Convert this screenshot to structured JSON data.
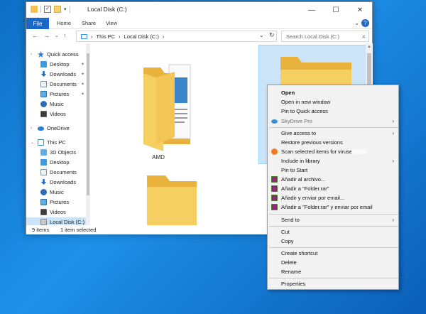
{
  "window": {
    "title": "Local Disk (C:)",
    "controls": [
      "—",
      "☐",
      "✕"
    ]
  },
  "ribbon": {
    "file_tab": "File",
    "tabs": [
      "Home",
      "Share",
      "View"
    ]
  },
  "address": {
    "back": "←",
    "forward": "→",
    "recent": "⌄",
    "up": "↑",
    "crumbs": [
      "This PC",
      "Local Disk (C:)"
    ],
    "search_placeholder": "Search Local Disk (C:)"
  },
  "nav": {
    "items": [
      {
        "label": "Quick access",
        "icon": "star-icon"
      },
      {
        "label": "Desktop",
        "icon": "desktop-icon",
        "pinned": true
      },
      {
        "label": "Downloads",
        "icon": "downloads-icon",
        "pinned": true
      },
      {
        "label": "Documents",
        "icon": "documents-icon",
        "pinned": true
      },
      {
        "label": "Pictures",
        "icon": "pictures-icon",
        "pinned": true
      },
      {
        "label": "Music",
        "icon": "music-icon"
      },
      {
        "label": "Videos",
        "icon": "videos-icon"
      },
      {
        "label": "OneDrive",
        "icon": "onedrive-icon"
      },
      {
        "label": "This PC",
        "icon": "this-pc-icon"
      },
      {
        "label": "3D Objects",
        "icon": "3d-objects-icon"
      },
      {
        "label": "Desktop",
        "icon": "desktop-icon"
      },
      {
        "label": "Documents",
        "icon": "documents-icon"
      },
      {
        "label": "Downloads",
        "icon": "downloads-icon"
      },
      {
        "label": "Music",
        "icon": "music-icon"
      },
      {
        "label": "Pictures",
        "icon": "pictures-icon"
      },
      {
        "label": "Videos",
        "icon": "videos-icon"
      },
      {
        "label": "Local Disk (C:)",
        "icon": "drive-icon",
        "selected": true
      }
    ]
  },
  "content": {
    "folders": [
      {
        "label": "AMD"
      }
    ]
  },
  "status": {
    "count": "9 items",
    "selected": "1 item selected"
  },
  "context_menu": {
    "items": [
      {
        "label": "Open",
        "bold": true
      },
      {
        "label": "Open in new window"
      },
      {
        "label": "Pin to Quick access"
      },
      {
        "label": "SkyDrive Pro",
        "dim": true,
        "submenu": true,
        "icon": "skydrive-icon"
      },
      {
        "label": "Give access to",
        "submenu": true
      },
      {
        "label": "Restore previous versions"
      },
      {
        "label": "Scan selected items for viruses",
        "icon": "avast-icon"
      },
      {
        "label": "Include in library",
        "submenu": true
      },
      {
        "label": "Pin to Start"
      },
      {
        "label": "Añadir al archivo...",
        "icon": "winrar-icon"
      },
      {
        "label": "Añadir a \"Folder.rar\"",
        "icon": "winrar-icon"
      },
      {
        "label": "Añadir y enviar por email...",
        "icon": "winrar-icon"
      },
      {
        "label": "Añadir a \"Folder.rar\" y enviar por email",
        "icon": "winrar-icon"
      },
      {
        "label": "Send to",
        "submenu": true
      },
      {
        "label": "Cut"
      },
      {
        "label": "Copy"
      },
      {
        "label": "Create shortcut"
      },
      {
        "label": "Delete"
      },
      {
        "label": "Rename"
      },
      {
        "label": "Properties"
      }
    ],
    "submenu_arrow": "›"
  },
  "colors": {
    "accent": "#1a68c7",
    "selection": "#cce4f7",
    "folder": "#f4c24f"
  }
}
